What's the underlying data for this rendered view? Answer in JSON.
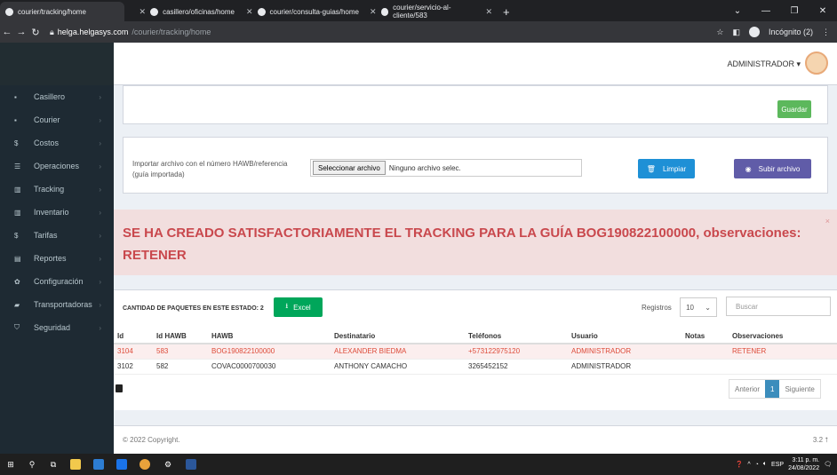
{
  "browser": {
    "tabs": [
      {
        "title": "courier/tracking/home",
        "active": true
      },
      {
        "title": "casillero/oficinas/home",
        "active": false
      },
      {
        "title": "courier/consulta-guias/home",
        "active": false
      },
      {
        "title": "courier/servicio-al-cliente/583",
        "active": false
      }
    ],
    "url_host": "helga.helgasys.com",
    "url_path": "/courier/tracking/home",
    "incognito_label": "Incógnito (2)"
  },
  "sidebar": {
    "items": [
      {
        "label": "Casillero",
        "icon": "box-icon"
      },
      {
        "label": "Courier",
        "icon": "box-icon"
      },
      {
        "label": "Costos",
        "icon": "dollar-icon"
      },
      {
        "label": "Operaciones",
        "icon": "list-icon"
      },
      {
        "label": "Tracking",
        "icon": "barcode-icon"
      },
      {
        "label": "Inventario",
        "icon": "barcode-icon"
      },
      {
        "label": "Tarifas",
        "icon": "dollar-icon"
      },
      {
        "label": "Reportes",
        "icon": "calendar-icon"
      },
      {
        "label": "Configuración",
        "icon": "gear-icon"
      },
      {
        "label": "Transportadoras",
        "icon": "truck-icon"
      },
      {
        "label": "Seguridad",
        "icon": "shield-icon"
      }
    ]
  },
  "header": {
    "user": "ADMINISTRADOR ▾"
  },
  "form": {
    "guardar": "Guardar",
    "import_label": "Importar archivo con el número HAWB/referencia (guía importada)",
    "file_button": "Seleccionar archivo",
    "file_value": "Ninguno archivo selec.",
    "limpiar": "Limpiar",
    "subir": "Subir archivo"
  },
  "alert": {
    "text": "SE HA CREADO SATISFACTORIAMENTE EL TRACKING PARA LA GUÍA BOG190822100000, observaciones: RETENER",
    "close": "×"
  },
  "table": {
    "count_label": "CANTIDAD DE PAQUETES EN ESTE ESTADO: 2",
    "excel": "Excel",
    "registros_label": "Registros",
    "registros_value": "10",
    "search_placeholder": "Buscar",
    "headers": [
      "Id",
      "Id HAWB",
      "HAWB",
      "Destinatario",
      "Teléfonos",
      "Usuario",
      "Notas",
      "Observaciones"
    ],
    "rows": [
      [
        "3104",
        "583",
        "BOG190822100000",
        "ALEXANDER BIEDMA",
        "+573122975120",
        "ADMINISTRADOR",
        "",
        "RETENER"
      ],
      [
        "3102",
        "582",
        "COVAC0000700030",
        "ANTHONY CAMACHO",
        "3265452152",
        "ADMINISTRADOR",
        "",
        ""
      ]
    ],
    "pager": {
      "prev": "Anterior",
      "page": "1",
      "next": "Siguiente"
    }
  },
  "footer": {
    "copyright": "© 2022 Copyright.",
    "version": "3.2"
  },
  "taskbar": {
    "lang": "ESP",
    "time": "3:11 p. m.",
    "date": "24/08/2022"
  },
  "colors": {
    "sidebar": "#1e2a33",
    "alert_bg": "#f2dede",
    "alert_text": "#c9484d",
    "primary": "#3c8dbc"
  }
}
